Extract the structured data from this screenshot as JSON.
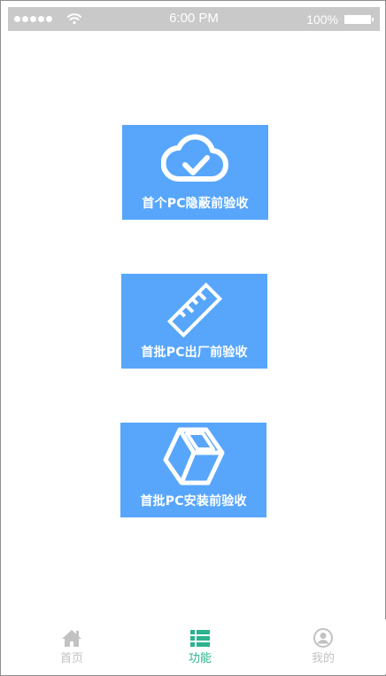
{
  "status_bar": {
    "time": "6:00 PM",
    "battery_percent": "100%",
    "signal_bars": 5,
    "battery_level": 1.0
  },
  "cards": [
    {
      "label": "首个PC隐蔽前验收",
      "icon": "cloud-check-icon"
    },
    {
      "label": "首批PC出厂前验收",
      "icon": "ruler-icon"
    },
    {
      "label": "首批PC安装前验收",
      "icon": "cube-icon"
    }
  ],
  "tab_bar": {
    "items": [
      {
        "label": "首页",
        "icon": "home-icon",
        "active": false
      },
      {
        "label": "功能",
        "icon": "list-icon",
        "active": true
      },
      {
        "label": "我的",
        "icon": "user-icon",
        "active": false
      }
    ]
  },
  "colors": {
    "card_background": "#57a6fb",
    "status_bar": "#c9c9c9",
    "tab_active": "#2bb38f",
    "tab_inactive": "#c2c2c2",
    "frame_border": "#8e8e8e"
  }
}
